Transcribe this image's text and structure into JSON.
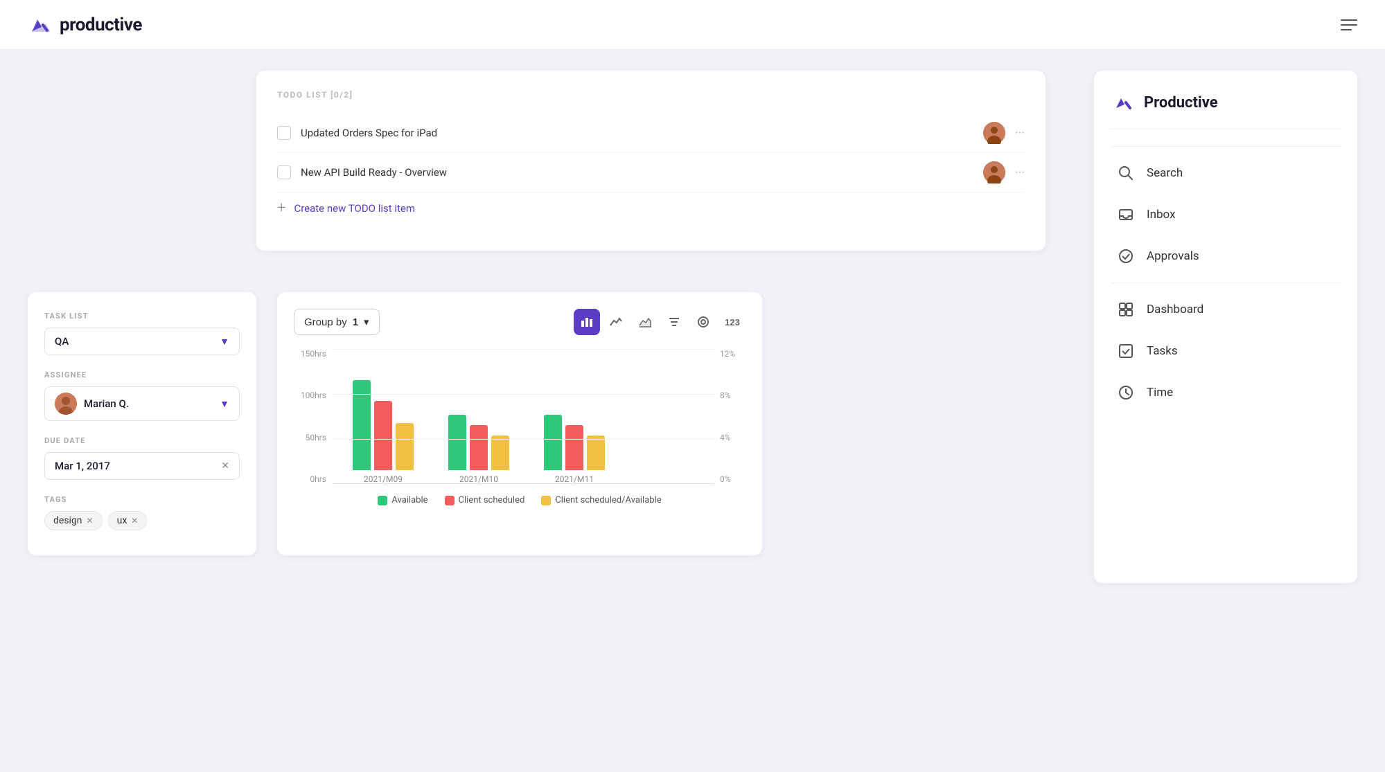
{
  "app": {
    "name": "productive",
    "logo_check": "✓"
  },
  "topnav": {
    "logo_text": "productive"
  },
  "todo": {
    "title": "TODO LIST [0/2]",
    "items": [
      {
        "text": "Updated Orders Spec for iPad"
      },
      {
        "text": "New API Build Ready - Overview"
      }
    ],
    "create_label": "Create new TODO list item"
  },
  "task_filters": {
    "task_list_label": "TASK LIST",
    "task_list_value": "QA",
    "assignee_label": "ASSIGNEE",
    "assignee_name": "Marian Q.",
    "due_date_label": "DUE DATE",
    "due_date_value": "Mar 1, 2017",
    "tags_label": "TAGS",
    "tags": [
      "design",
      "ux"
    ]
  },
  "chart": {
    "group_by_label": "Group by",
    "group_by_value": "1",
    "y_labels_left": [
      "150hrs",
      "100hrs",
      "50hrs",
      "0hrs"
    ],
    "y_labels_right": [
      "12%",
      "8%",
      "4%",
      "0%"
    ],
    "bar_groups": [
      {
        "label": "2021/M09",
        "available": 130,
        "client_scheduled": 100,
        "client_scheduled_available": 70
      },
      {
        "label": "2021/M10",
        "available": 80,
        "client_scheduled": 70,
        "client_scheduled_available": 55
      },
      {
        "label": "2021/M11",
        "available": 80,
        "client_scheduled": 70,
        "client_scheduled_available": 55
      }
    ],
    "legend": [
      {
        "label": "Available",
        "color": "#2ec87b"
      },
      {
        "label": "Client scheduled",
        "color": "#f25c5c"
      },
      {
        "label": "Client scheduled/Available",
        "color": "#f0c040"
      }
    ]
  },
  "app_menu": {
    "title": "Productive",
    "items": [
      {
        "icon": "search",
        "label": "Search"
      },
      {
        "icon": "inbox",
        "label": "Inbox"
      },
      {
        "icon": "approvals",
        "label": "Approvals"
      },
      {
        "icon": "dashboard",
        "label": "Dashboard"
      },
      {
        "icon": "tasks",
        "label": "Tasks"
      },
      {
        "icon": "time",
        "label": "Time"
      }
    ]
  }
}
